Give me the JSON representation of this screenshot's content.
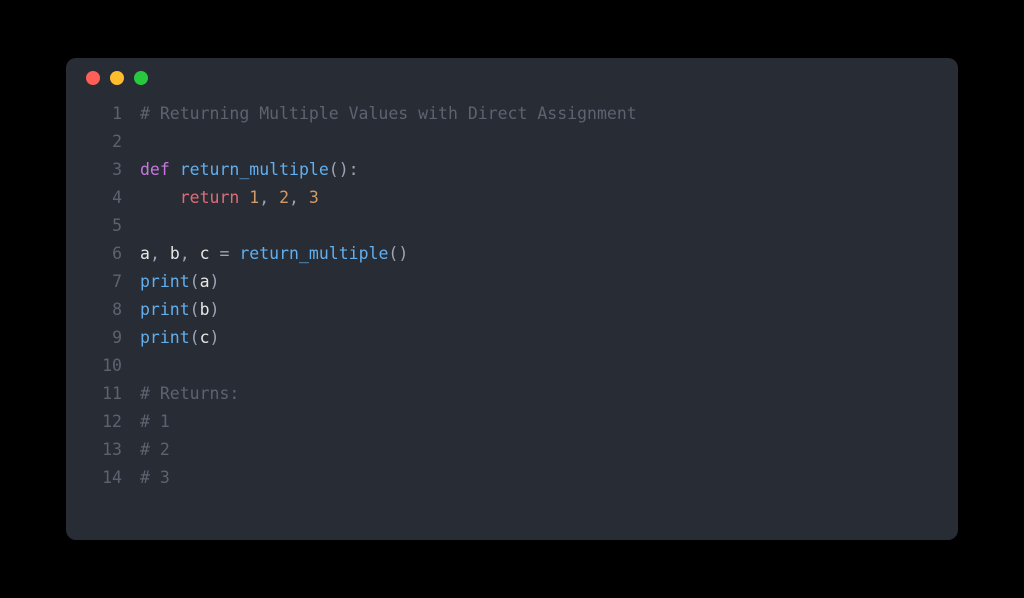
{
  "window": {
    "dots": {
      "red": "#ff5f56",
      "yellow": "#ffbd2e",
      "green": "#27c93f"
    }
  },
  "code": {
    "lines": [
      {
        "n": 1,
        "tokens": [
          {
            "t": "# Returning Multiple Values with Direct Assignment",
            "c": "tok-comment"
          }
        ]
      },
      {
        "n": 2,
        "tokens": []
      },
      {
        "n": 3,
        "tokens": [
          {
            "t": "def",
            "c": "tok-def"
          },
          {
            "t": " ",
            "c": ""
          },
          {
            "t": "return_multiple",
            "c": "tok-func"
          },
          {
            "t": "():",
            "c": "tok-punct"
          }
        ]
      },
      {
        "n": 4,
        "tokens": [
          {
            "t": "    ",
            "c": ""
          },
          {
            "t": "return",
            "c": "tok-return"
          },
          {
            "t": " ",
            "c": ""
          },
          {
            "t": "1",
            "c": "tok-number"
          },
          {
            "t": ", ",
            "c": "tok-punct"
          },
          {
            "t": "2",
            "c": "tok-number"
          },
          {
            "t": ", ",
            "c": "tok-punct"
          },
          {
            "t": "3",
            "c": "tok-number"
          }
        ]
      },
      {
        "n": 5,
        "tokens": []
      },
      {
        "n": 6,
        "tokens": [
          {
            "t": "a",
            "c": "tok-ident"
          },
          {
            "t": ", ",
            "c": "tok-punct"
          },
          {
            "t": "b",
            "c": "tok-ident"
          },
          {
            "t": ", ",
            "c": "tok-punct"
          },
          {
            "t": "c",
            "c": "tok-ident"
          },
          {
            "t": " ",
            "c": ""
          },
          {
            "t": "=",
            "c": "tok-punct"
          },
          {
            "t": " ",
            "c": ""
          },
          {
            "t": "return_multiple",
            "c": "tok-func"
          },
          {
            "t": "()",
            "c": "tok-punct"
          }
        ]
      },
      {
        "n": 7,
        "tokens": [
          {
            "t": "print",
            "c": "tok-func"
          },
          {
            "t": "(",
            "c": "tok-punct"
          },
          {
            "t": "a",
            "c": "tok-ident"
          },
          {
            "t": ")",
            "c": "tok-punct"
          }
        ]
      },
      {
        "n": 8,
        "tokens": [
          {
            "t": "print",
            "c": "tok-func"
          },
          {
            "t": "(",
            "c": "tok-punct"
          },
          {
            "t": "b",
            "c": "tok-ident"
          },
          {
            "t": ")",
            "c": "tok-punct"
          }
        ]
      },
      {
        "n": 9,
        "tokens": [
          {
            "t": "print",
            "c": "tok-func"
          },
          {
            "t": "(",
            "c": "tok-punct"
          },
          {
            "t": "c",
            "c": "tok-ident"
          },
          {
            "t": ")",
            "c": "tok-punct"
          }
        ]
      },
      {
        "n": 10,
        "tokens": []
      },
      {
        "n": 11,
        "tokens": [
          {
            "t": "# Returns:",
            "c": "tok-comment"
          }
        ]
      },
      {
        "n": 12,
        "tokens": [
          {
            "t": "# 1",
            "c": "tok-comment"
          }
        ]
      },
      {
        "n": 13,
        "tokens": [
          {
            "t": "# 2",
            "c": "tok-comment"
          }
        ]
      },
      {
        "n": 14,
        "tokens": [
          {
            "t": "# 3",
            "c": "tok-comment"
          }
        ]
      }
    ]
  }
}
